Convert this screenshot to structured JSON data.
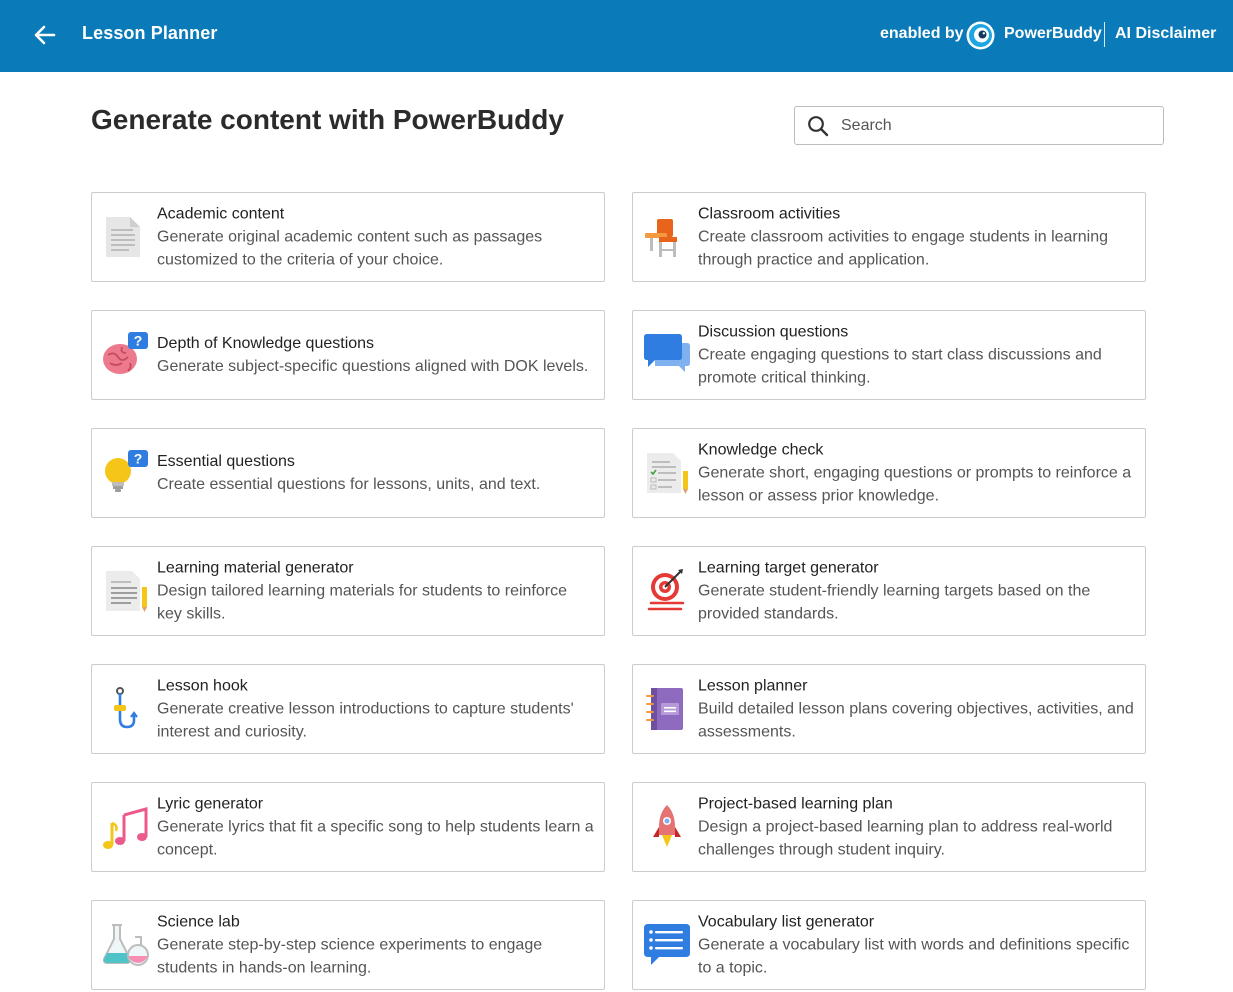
{
  "header": {
    "title": "Lesson Planner",
    "enabled_by": "enabled by",
    "brand": "PowerBuddy",
    "disclaimer": "AI Disclaimer",
    "bg_color": "#0a7ab8"
  },
  "main": {
    "heading": "Generate content with PowerBuddy",
    "search": {
      "placeholder": "Search",
      "value": ""
    }
  },
  "cards": [
    {
      "title": "Academic content",
      "desc": "Generate original academic content such as passages customized to the criteria of your choice.",
      "icon": "document-icon"
    },
    {
      "title": "Classroom activities",
      "desc": "Create classroom activities to engage students in learning through practice and application.",
      "icon": "school-desk-icon"
    },
    {
      "title": "Depth of Knowledge questions",
      "desc": "Generate subject-specific questions aligned with DOK levels.",
      "icon": "brain-question-icon"
    },
    {
      "title": "Discussion questions",
      "desc": "Create engaging questions to start class discussions and promote critical thinking.",
      "icon": "chat-bubbles-icon"
    },
    {
      "title": "Essential questions",
      "desc": "Create essential questions for lessons, units, and text.",
      "icon": "lightbulb-question-icon"
    },
    {
      "title": "Knowledge check",
      "desc": "Generate short, engaging questions or prompts to reinforce a lesson or assess prior knowledge.",
      "icon": "checklist-icon"
    },
    {
      "title": "Learning material generator",
      "desc": "Design tailored learning materials for students to reinforce key skills.",
      "icon": "worksheet-icon"
    },
    {
      "title": "Learning target generator",
      "desc": "Generate student-friendly learning targets based on the provided standards.",
      "icon": "target-icon"
    },
    {
      "title": "Lesson hook",
      "desc": "Generate creative lesson introductions to capture students' interest and curiosity.",
      "icon": "fishing-hook-icon"
    },
    {
      "title": "Lesson planner",
      "desc": "Build detailed lesson plans covering objectives, activities, and assessments.",
      "icon": "notebook-icon"
    },
    {
      "title": "Lyric generator",
      "desc": "Generate lyrics that fit a specific song to help students learn a concept.",
      "icon": "music-notes-icon"
    },
    {
      "title": "Project-based learning plan",
      "desc": "Design a project-based learning plan to address real-world challenges through student inquiry.",
      "icon": "rocket-icon"
    },
    {
      "title": "Science lab",
      "desc": "Generate step-by-step science experiments to engage students in hands-on learning.",
      "icon": "lab-flasks-icon"
    },
    {
      "title": "Vocabulary list generator",
      "desc": "Generate a vocabulary list with words and definitions specific to a topic.",
      "icon": "list-bubble-icon"
    }
  ]
}
